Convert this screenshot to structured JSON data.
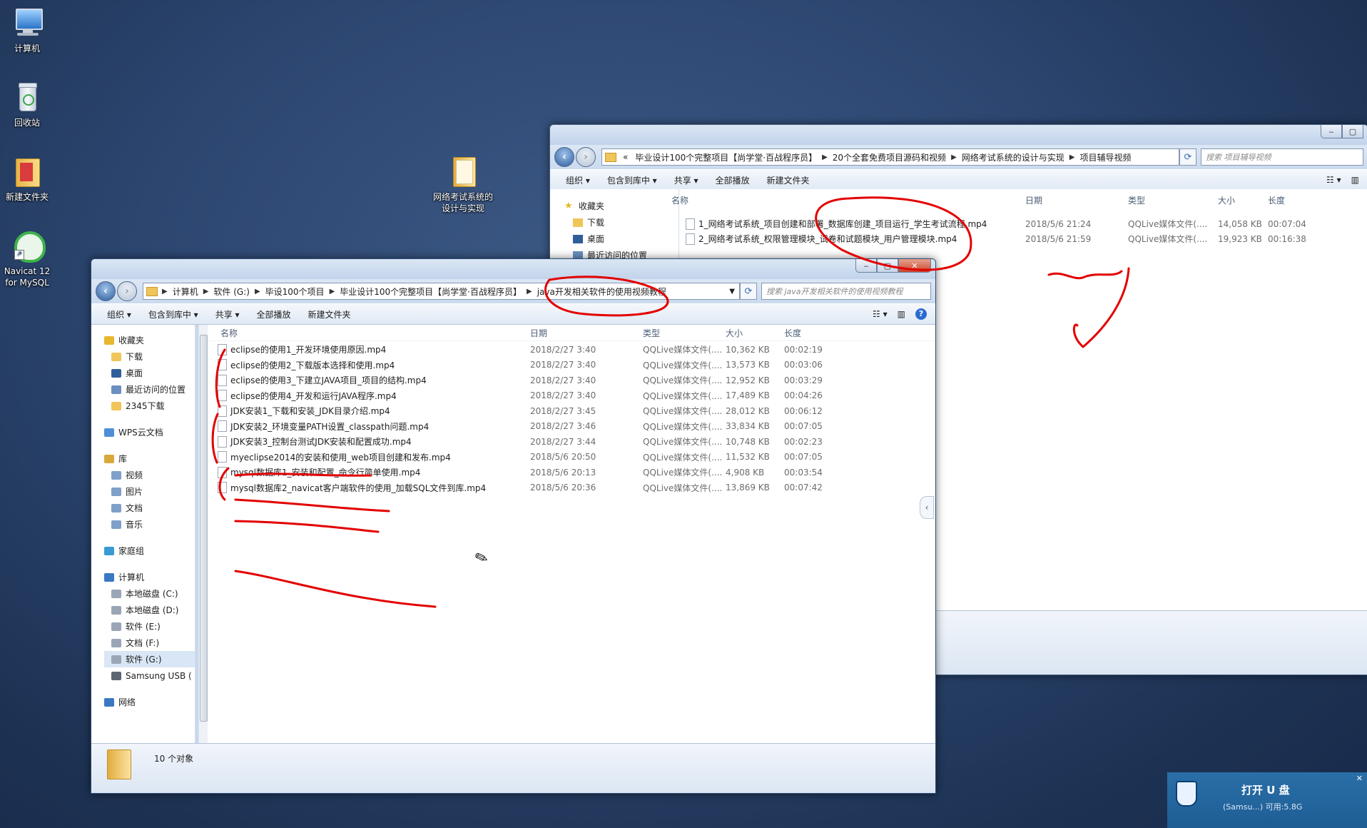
{
  "desktop": {
    "icons": [
      {
        "label": "计算机",
        "icon": "computer-icon"
      },
      {
        "label": "回收站",
        "icon": "recycle-bin-icon"
      },
      {
        "label": "新建文件夹",
        "icon": "folder-icon"
      },
      {
        "label": "Navicat 12 for MySQL",
        "icon": "navicat-icon"
      },
      {
        "label": "网络考试系统的设计与实现",
        "icon": "folder-icon"
      }
    ]
  },
  "back_window": {
    "breadcrumb": [
      "«",
      "毕业设计100个完整项目【尚学堂·百战程序员】",
      "20个全套免费项目源码和视频",
      "网络考试系统的设计与实现",
      "项目辅导视频"
    ],
    "search_placeholder": "搜索 项目辅导视频",
    "toolbar": [
      "组织 ▾",
      "包含到库中 ▾",
      "共享 ▾",
      "全部播放",
      "新建文件夹"
    ],
    "nav_items": [
      "收藏夹",
      "下载",
      "桌面",
      "最近访问的位置"
    ],
    "columns": [
      "名称",
      "日期",
      "类型",
      "大小",
      "长度"
    ],
    "files": [
      {
        "name": "1_网络考试系统_项目创建和部署_数据库创建_项目运行_学生考试流程.mp4",
        "date": "2018/5/6 21:24",
        "type": "QQLive媒体文件(....",
        "size": "14,058 KB",
        "length": "00:07:04"
      },
      {
        "name": "2_网络考试系统_权限管理模块_试卷和试题模块_用户管理模块.mp4",
        "date": "2018/5/6 21:59",
        "type": "QQLive媒体文件(....",
        "size": "19,923 KB",
        "length": "00:16:38"
      }
    ]
  },
  "front_window": {
    "breadcrumb": [
      "计算机",
      "软件 (G:)",
      "毕设100个项目",
      "毕业设计100个完整项目【尚学堂·百战程序员】",
      "java开发相关软件的使用视频教程"
    ],
    "search_placeholder": "搜索 java开发相关软件的使用视频教程",
    "toolbar": [
      "组织 ▾",
      "包含到库中 ▾",
      "共享 ▾",
      "全部播放",
      "新建文件夹"
    ],
    "nav_items": [
      {
        "label": "收藏夹",
        "indent": 0,
        "icon": "star-icon"
      },
      {
        "label": "下载",
        "indent": 1,
        "icon": "download-folder-icon"
      },
      {
        "label": "桌面",
        "indent": 1,
        "icon": "desktop-icon"
      },
      {
        "label": "最近访问的位置",
        "indent": 1,
        "icon": "recent-places-icon"
      },
      {
        "label": "2345下载",
        "indent": 1,
        "icon": "folder-icon"
      },
      {
        "label": "",
        "indent": 0,
        "icon": ""
      },
      {
        "label": "WPS云文档",
        "indent": 0,
        "icon": "cloud-icon"
      },
      {
        "label": "",
        "indent": 0,
        "icon": ""
      },
      {
        "label": "库",
        "indent": 0,
        "icon": "library-icon"
      },
      {
        "label": "视频",
        "indent": 1,
        "icon": "video-library-icon"
      },
      {
        "label": "图片",
        "indent": 1,
        "icon": "picture-library-icon"
      },
      {
        "label": "文档",
        "indent": 1,
        "icon": "document-library-icon"
      },
      {
        "label": "音乐",
        "indent": 1,
        "icon": "music-library-icon"
      },
      {
        "label": "",
        "indent": 0,
        "icon": ""
      },
      {
        "label": "家庭组",
        "indent": 0,
        "icon": "homegroup-icon"
      },
      {
        "label": "",
        "indent": 0,
        "icon": ""
      },
      {
        "label": "计算机",
        "indent": 0,
        "icon": "computer-icon"
      },
      {
        "label": "本地磁盘 (C:)",
        "indent": 1,
        "icon": "drive-icon"
      },
      {
        "label": "本地磁盘 (D:)",
        "indent": 1,
        "icon": "drive-icon"
      },
      {
        "label": "软件 (E:)",
        "indent": 1,
        "icon": "drive-icon"
      },
      {
        "label": "文档 (F:)",
        "indent": 1,
        "icon": "drive-icon"
      },
      {
        "label": "软件 (G:)",
        "indent": 1,
        "icon": "drive-icon",
        "selected": true
      },
      {
        "label": "Samsung USB (",
        "indent": 1,
        "icon": "usb-drive-icon"
      },
      {
        "label": "",
        "indent": 0,
        "icon": ""
      },
      {
        "label": "网络",
        "indent": 0,
        "icon": "network-icon"
      }
    ],
    "columns": [
      "名称",
      "日期",
      "类型",
      "大小",
      "长度"
    ],
    "files": [
      {
        "name": "eclipse的使用1_开发环境使用原因.mp4",
        "date": "2018/2/27 3:40",
        "type": "QQLive媒体文件(....",
        "size": "10,362 KB",
        "length": "00:02:19"
      },
      {
        "name": "eclipse的使用2_下载版本选择和使用.mp4",
        "date": "2018/2/27 3:40",
        "type": "QQLive媒体文件(....",
        "size": "13,573 KB",
        "length": "00:03:06"
      },
      {
        "name": "eclipse的使用3_下建立JAVA项目_项目的结构.mp4",
        "date": "2018/2/27 3:40",
        "type": "QQLive媒体文件(....",
        "size": "12,952 KB",
        "length": "00:03:29"
      },
      {
        "name": "eclipse的使用4_开发和运行JAVA程序.mp4",
        "date": "2018/2/27 3:40",
        "type": "QQLive媒体文件(....",
        "size": "17,489 KB",
        "length": "00:04:26"
      },
      {
        "name": "JDK安装1_下载和安装_JDK目录介绍.mp4",
        "date": "2018/2/27 3:45",
        "type": "QQLive媒体文件(....",
        "size": "28,012 KB",
        "length": "00:06:12"
      },
      {
        "name": "JDK安装2_环境变量PATH设置_classpath问题.mp4",
        "date": "2018/2/27 3:46",
        "type": "QQLive媒体文件(....",
        "size": "33,834 KB",
        "length": "00:07:05"
      },
      {
        "name": "JDK安装3_控制台测试JDK安装和配置成功.mp4",
        "date": "2018/2/27 3:44",
        "type": "QQLive媒体文件(....",
        "size": "10,748 KB",
        "length": "00:02:23"
      },
      {
        "name": "myeclipse2014的安装和使用_web项目创建和发布.mp4",
        "date": "2018/5/6 20:50",
        "type": "QQLive媒体文件(....",
        "size": "11,532 KB",
        "length": "00:07:05"
      },
      {
        "name": "mysql数据库1_安装和配置_命令行简单使用.mp4",
        "date": "2018/5/6 20:13",
        "type": "QQLive媒体文件(....",
        "size": "4,908 KB",
        "length": "00:03:54"
      },
      {
        "name": "mysql数据库2_navicat客户端软件的使用_加载SQL文件到库.mp4",
        "date": "2018/5/6 20:36",
        "type": "QQLive媒体文件(....",
        "size": "13,869 KB",
        "length": "00:07:42"
      }
    ],
    "status": "10 个对象"
  },
  "usb_popup": {
    "title": "打开 U 盘",
    "subtitle": "(Samsu...)  可用:5.8G"
  },
  "colors": {
    "annotation": "#e30000",
    "selection": "#cde8ff"
  }
}
